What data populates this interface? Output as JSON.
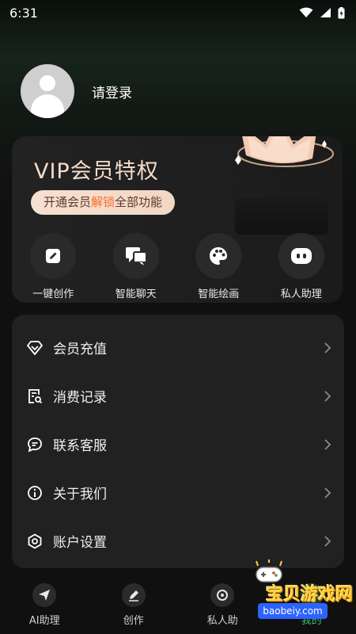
{
  "status_bar": {
    "time": "6:31"
  },
  "profile": {
    "login_text": "请登录"
  },
  "vip": {
    "title": "VIP会员特权",
    "pill_prefix": "开通会员",
    "pill_highlight": "解锁",
    "pill_suffix": "全部功能",
    "features": [
      {
        "icon": "edit-icon",
        "label": "一键创作"
      },
      {
        "icon": "chat-icon",
        "label": "智能聊天"
      },
      {
        "icon": "palette-icon",
        "label": "智能绘画"
      },
      {
        "icon": "robot-icon",
        "label": "私人助理"
      }
    ]
  },
  "menu": {
    "items": [
      {
        "icon": "diamond-icon",
        "label": "会员充值"
      },
      {
        "icon": "receipt-icon",
        "label": "消费记录"
      },
      {
        "icon": "message-icon",
        "label": "联系客服"
      },
      {
        "icon": "info-icon",
        "label": "关于我们"
      },
      {
        "icon": "settings-icon",
        "label": "账户设置"
      }
    ]
  },
  "tabbar": {
    "items": [
      {
        "icon": "send-icon",
        "label": "AI助理"
      },
      {
        "icon": "pen-icon",
        "label": "创作"
      },
      {
        "icon": "assistant-icon",
        "label": "私人助"
      },
      {
        "icon": "user-icon",
        "label": "我的"
      }
    ],
    "active_index": 3
  },
  "watermark": {
    "title": "宝贝游戏网",
    "url": "baobeiy.com"
  },
  "colors": {
    "background": "#101010",
    "card": "#212121",
    "vip_title": "#f4dccb",
    "pill_highlight": "#ff6a2a",
    "active_tab": "#39c26a"
  }
}
